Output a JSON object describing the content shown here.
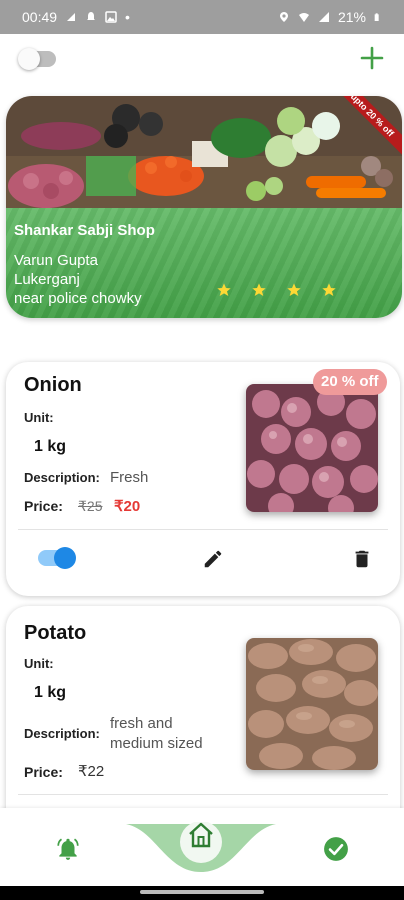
{
  "status_bar": {
    "time": "00:49",
    "battery": "21%"
  },
  "shop": {
    "discount_ribbon": "upto 20 % off",
    "name": "Shankar Sabji Shop",
    "owner": "Varun Gupta",
    "area": "Lukerganj",
    "landmark": "near police chowky",
    "rating": 4
  },
  "products": [
    {
      "name": "Onion",
      "unit_label": "Unit:",
      "unit": "1 kg",
      "description_label": "Description:",
      "description": "Fresh",
      "price_label": "Price:",
      "price_old": "₹25",
      "price_new": "₹20",
      "discount_badge": "20 % off",
      "available": true
    },
    {
      "name": "Potato",
      "unit_label": "Unit:",
      "unit": "1 kg",
      "description_label": "Description:",
      "description_line1": "fresh and",
      "description_line2": "medium sized",
      "price_label": "Price:",
      "price": "₹22"
    }
  ],
  "colors": {
    "brand_green": "#43a047",
    "discount_red": "#e53935",
    "toggle_blue": "#1e88e5"
  }
}
